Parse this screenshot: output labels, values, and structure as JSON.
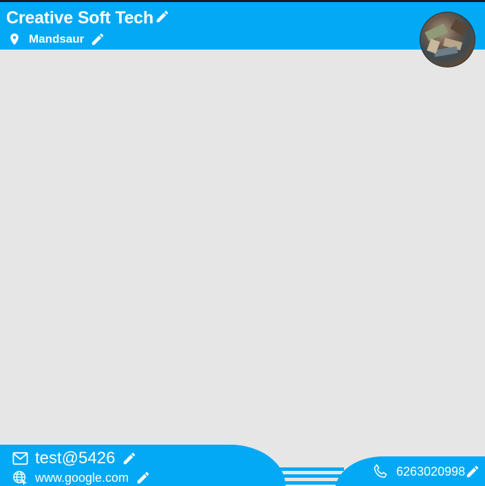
{
  "header": {
    "company_name": "Creative Soft Tech",
    "location": "Mandsaur"
  },
  "footer": {
    "email": "test@5426",
    "website": "www.google.com",
    "phone": "6263020998"
  },
  "icons": {
    "title_edit": "pencil-icon",
    "location": "map-pin-icon",
    "location_edit": "pencil-icon",
    "email": "mail-icon",
    "email_edit": "pencil-icon",
    "website": "globe-icon",
    "website_edit": "pencil-icon",
    "phone": "phone-icon",
    "phone_edit": "pencil-icon"
  },
  "colors": {
    "accent": "#03a9f4",
    "canvas": "#e6e6e6",
    "text": "#ffffff"
  }
}
